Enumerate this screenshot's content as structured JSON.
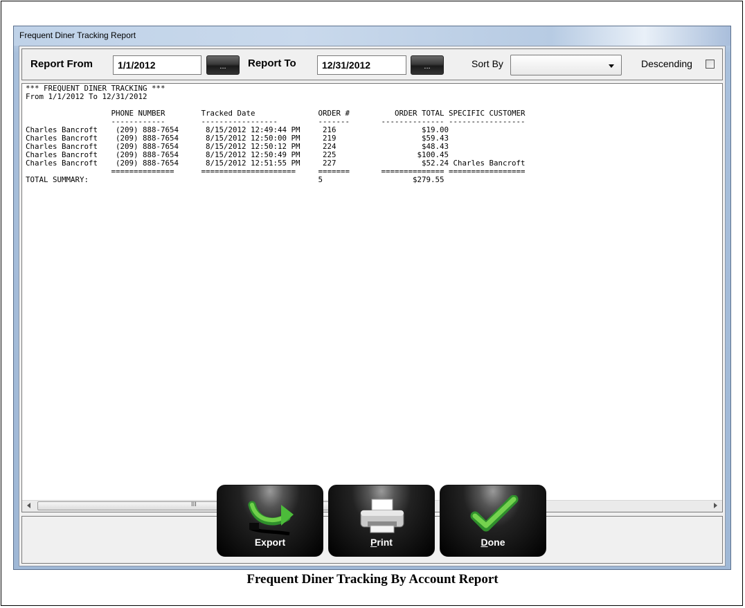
{
  "window": {
    "title": "Frequent Diner Tracking Report"
  },
  "toolbar": {
    "report_from_label": "Report From",
    "report_from_value": "1/1/2012",
    "report_to_label": "Report To",
    "report_to_value": "12/31/2012",
    "date_picker_label": "...",
    "sort_by_label": "Sort By",
    "sort_by_value": "",
    "descending_label": "Descending",
    "descending_checked": false
  },
  "report": {
    "lines": [
      "*** FREQUENT DINER TRACKING ***",
      "From 1/1/2012 To 12/31/2012",
      "",
      "                   PHONE NUMBER        Tracked Date              ORDER #          ORDER TOTAL SPECIFIC CUSTOMER",
      "                   ------------        -----------------         -------       -------------- -----------------",
      "Charles Bancroft    (209) 888-7654      8/15/2012 12:49:44 PM     216                   $19.00",
      "Charles Bancroft    (209) 888-7654      8/15/2012 12:50:00 PM     219                   $59.43",
      "Charles Bancroft    (209) 888-7654      8/15/2012 12:50:12 PM     224                   $48.43",
      "Charles Bancroft    (209) 888-7654      8/15/2012 12:50:49 PM     225                  $100.45",
      "Charles Bancroft    (209) 888-7654      8/15/2012 12:51:55 PM     227                   $52.24 Charles Bancroft",
      "                   ==============      =====================     =======       ============== =================",
      "TOTAL SUMMARY:                                                   5                    $279.55"
    ],
    "scroll_grip": "III"
  },
  "buttons": {
    "export_label": "Export",
    "print_label": "Print",
    "done_label": "Done"
  },
  "caption": "Frequent Diner Tracking By Account Report",
  "icons": {
    "export": "export-arrow-icon",
    "print": "printer-icon",
    "done": "checkmark-icon"
  },
  "colors": {
    "title_bar": "#bfd2e8",
    "button_face": "#111111",
    "checkmark": "#4caf2a",
    "export_arrow": "#3aa535"
  }
}
